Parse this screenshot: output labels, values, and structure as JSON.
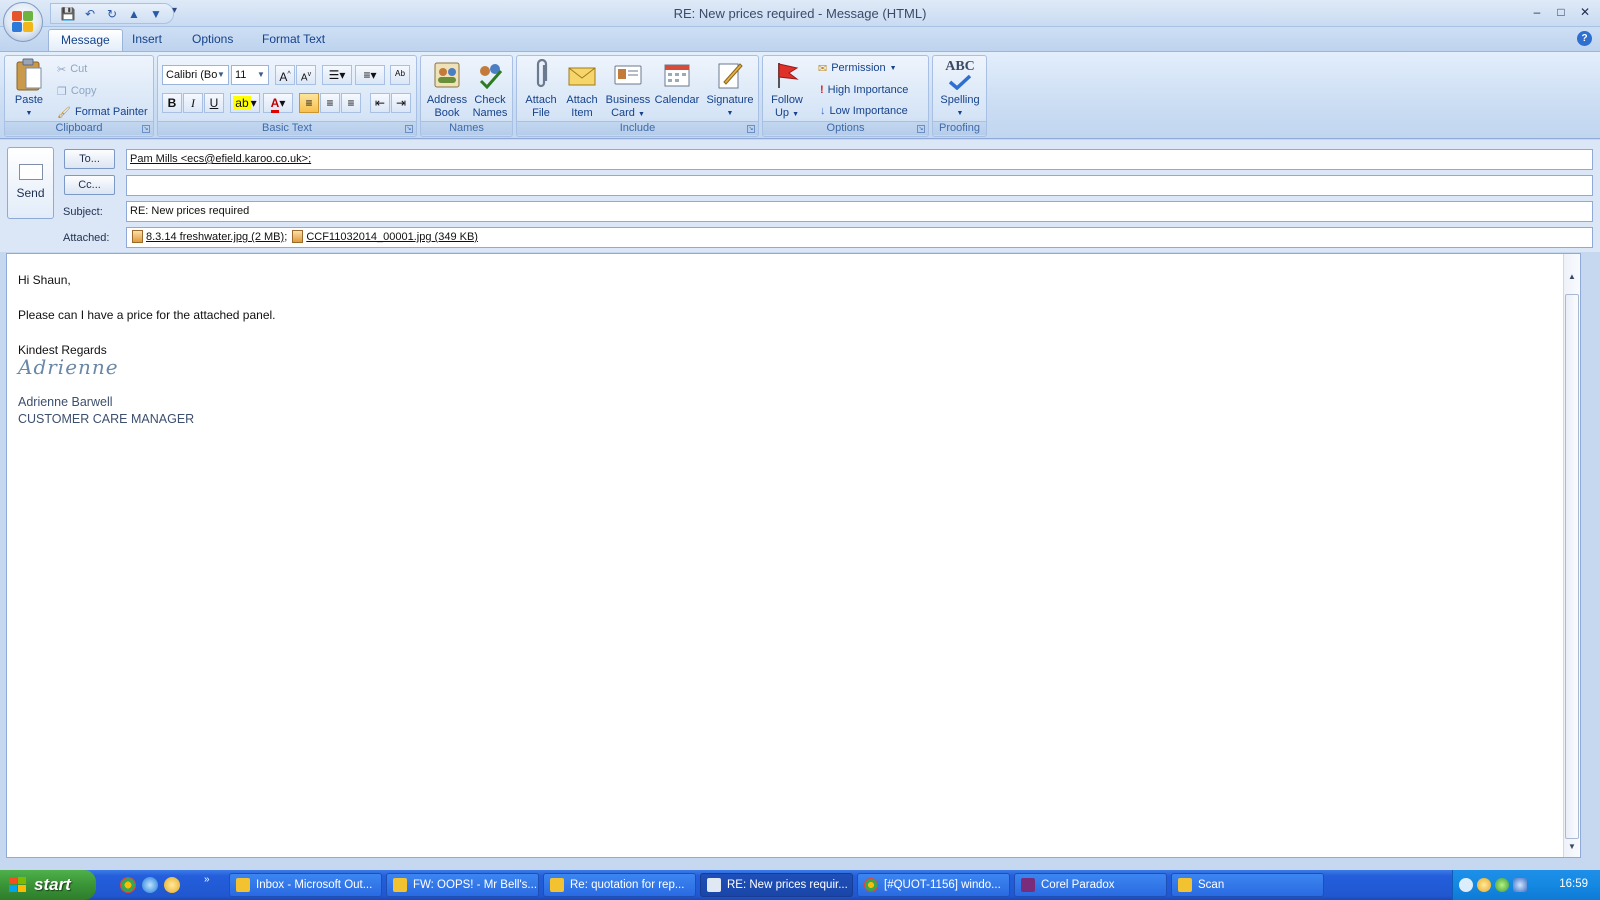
{
  "window": {
    "title": "RE: New prices required - Message (HTML)",
    "controls": {
      "minimize": "–",
      "maximize": "□",
      "close": "✕"
    }
  },
  "tabs": [
    {
      "label": "Message",
      "active": true
    },
    {
      "label": "Insert",
      "active": false
    },
    {
      "label": "Options",
      "active": false
    },
    {
      "label": "Format Text",
      "active": false
    }
  ],
  "ribbon": {
    "clipboard": {
      "label": "Clipboard",
      "paste": "Paste",
      "cut": "Cut",
      "copy": "Copy",
      "format_painter": "Format Painter"
    },
    "basic_text": {
      "label": "Basic Text",
      "font": "Calibri (Bo",
      "size": "11",
      "bold": "B",
      "italic": "I",
      "underline": "U"
    },
    "names": {
      "label": "Names",
      "address_book_1": "Address",
      "address_book_2": "Book",
      "check_names_1": "Check",
      "check_names_2": "Names"
    },
    "include": {
      "label": "Include",
      "attach_file_1": "Attach",
      "attach_file_2": "File",
      "attach_item_1": "Attach",
      "attach_item_2": "Item",
      "business_card_1": "Business",
      "business_card_2": "Card",
      "calendar": "Calendar",
      "signature": "Signature"
    },
    "options": {
      "label": "Options",
      "follow_up_1": "Follow",
      "follow_up_2": "Up",
      "permission": "Permission",
      "high_importance": "High Importance",
      "low_importance": "Low Importance"
    },
    "proofing": {
      "label": "Proofing",
      "spelling_icon": "ABC",
      "spelling": "Spelling"
    }
  },
  "compose": {
    "send_label": "Send",
    "to_button": "To...",
    "cc_button": "Cc...",
    "to_value": "Pam Mills <ecs@efield.karoo.co.uk>;",
    "cc_value": "",
    "subject_label": "Subject:",
    "subject_value": "RE: New prices required",
    "attached_label": "Attached:",
    "attachments": [
      {
        "name": "8.3.14 freshwater.jpg (2 MB)",
        "sep": ";"
      },
      {
        "name": "CCF11032014_00001.jpg (349 KB)",
        "sep": ""
      }
    ]
  },
  "body": {
    "greeting": "Hi Shaun,",
    "line1": "Please can I have a price for the attached panel.",
    "closing": "Kindest Regards",
    "signature_script": "Adrienne",
    "sig_name": "Adrienne Barwell",
    "sig_title": "CUSTOMER CARE MANAGER"
  },
  "taskbar": {
    "start": "start",
    "tasks": [
      {
        "label": "Inbox - Microsoft Out...",
        "active": false,
        "color": "#f2c230"
      },
      {
        "label": "FW: OOPS! - Mr Bell's...",
        "active": false,
        "color": "#f2c230"
      },
      {
        "label": "Re: quotation for rep...",
        "active": false,
        "color": "#f2c230"
      },
      {
        "label": "RE: New prices requir...",
        "active": true,
        "color": "#f2c230"
      },
      {
        "label": "[#QUOT-1156] windo...",
        "active": false,
        "color": "#db4437"
      },
      {
        "label": "Corel Paradox",
        "active": false,
        "color": "#7a2c7a"
      },
      {
        "label": "Scan",
        "active": false,
        "color": "#f2c230"
      }
    ],
    "clock": "16:59"
  }
}
